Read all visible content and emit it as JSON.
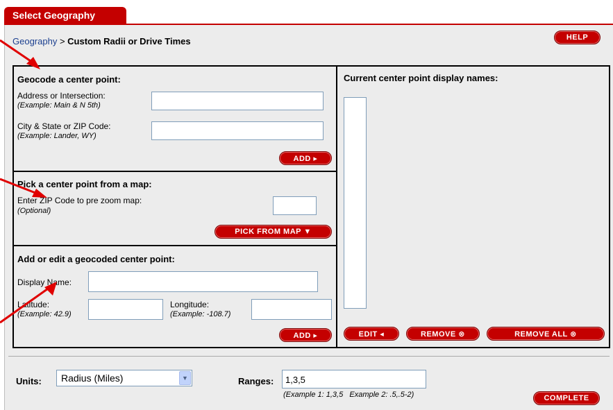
{
  "tab": {
    "label": "Select Geography"
  },
  "breadcrumb": {
    "link": "Geography",
    "sep": " > ",
    "current": "Custom Radii or Drive Times"
  },
  "help_label": "HELP",
  "geocode": {
    "title": "Geocode a center point:",
    "address_label": "Address or Intersection:",
    "address_example": "(Example: Main & N 5th)",
    "address_value": "",
    "city_label": "City & State or ZIP Code:",
    "city_example": "(Example: Lander, WY)",
    "city_value": "",
    "add_label": "ADD ▸"
  },
  "map_pick": {
    "title": "Pick a center point from a map:",
    "zip_label": "Enter ZIP Code to pre zoom map:",
    "zip_optional": "(Optional)",
    "zip_value": "",
    "button_label": "PICK FROM MAP ▼"
  },
  "edit_point": {
    "title": "Add or edit a geocoded center point:",
    "display_name_label": "Display Name:",
    "display_name_value": "",
    "latitude_label": "Latitude:",
    "latitude_example": "(Example: 42.9)",
    "latitude_value": "",
    "longitude_label": "Longitude:",
    "longitude_example": "(Example: -108.7)",
    "longitude_value": "",
    "add_label": "ADD ▸"
  },
  "current": {
    "title": "Current center point display names:",
    "edit_label": "EDIT ◂",
    "remove_label": "REMOVE ⊗",
    "remove_all_label": "REMOVE ALL ⊗"
  },
  "footer": {
    "units_label": "Units:",
    "units_value": "Radius (Miles)",
    "ranges_label": "Ranges:",
    "ranges_value": "1,3,5",
    "ranges_example": "(Example 1: 1,3,5   Example 2: .5,.5-2)",
    "complete_label": "COMPLETE"
  },
  "colors": {
    "accent": "#c40000",
    "panel": "#ececec",
    "arrow": "#e00000"
  },
  "icons": [
    "arrow-right-icon",
    "arrow-down-icon",
    "dropdown-chevron-icon",
    "circle-x-icon"
  ]
}
